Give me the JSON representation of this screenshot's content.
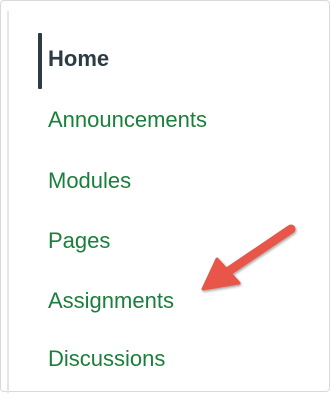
{
  "course_nav": {
    "items": [
      {
        "label": "Home",
        "active": true
      },
      {
        "label": "Announcements",
        "active": false
      },
      {
        "label": "Modules",
        "active": false
      },
      {
        "label": "Pages",
        "active": false
      },
      {
        "label": "Assignments",
        "active": false
      },
      {
        "label": "Discussions",
        "active": false
      }
    ]
  },
  "colors": {
    "link": "#1a7f3b",
    "active_text": "#2d3b45",
    "active_bar": "#2d3b45",
    "arrow": "#e8564a"
  },
  "annotation": {
    "icon": "arrow-pointer-icon",
    "points_to": "Assignments"
  }
}
